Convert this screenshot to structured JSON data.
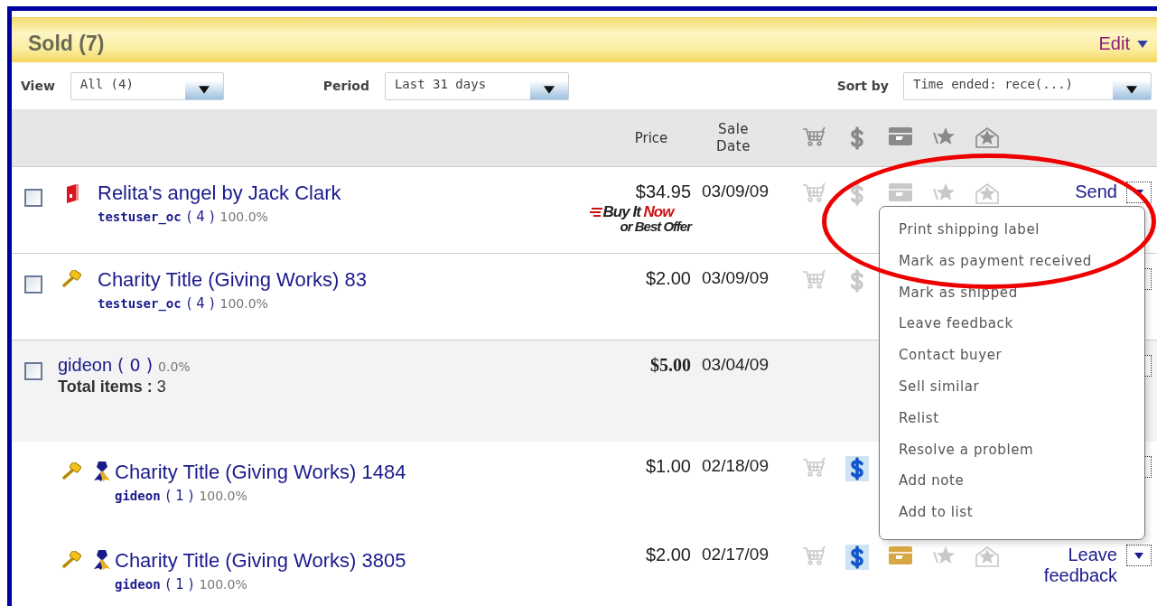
{
  "header": {
    "title": "Sold (7)",
    "edit": "Edit"
  },
  "filters": [
    {
      "label": "View",
      "value": "All (4)"
    },
    {
      "label": "Period",
      "value": "Last 31 days"
    },
    {
      "label": "Sort by",
      "value": "Time ended: rece(...)"
    }
  ],
  "columns": {
    "price": "Price",
    "sale_date": "Sale Date",
    "status_icons": [
      {
        "kind": "cart"
      },
      {
        "kind": "payment"
      },
      {
        "kind": "shipping"
      },
      {
        "kind": "feedback_left"
      },
      {
        "kind": "feedback_received"
      }
    ]
  },
  "rows": [
    {
      "kind": "item",
      "checked": false,
      "auction": false,
      "charity": false,
      "title": "Relita's angel by Jack Clark",
      "seller": "testuser_oc",
      "score": "( 4 )",
      "rating": "100.0%",
      "price": "$34.95",
      "date": "03/09/09",
      "format_logo": {
        "line_1": "Buy It",
        "line_1_accent": "Now",
        "line_2": "or Best Offer"
      },
      "status": [
        {
          "kind": "cart",
          "on": false
        },
        {
          "kind": "payment",
          "on": false
        },
        {
          "kind": "shipping",
          "on": false
        },
        {
          "kind": "feedback_left",
          "on": false
        },
        {
          "kind": "feedback_received",
          "on": false
        }
      ],
      "action": "Send"
    },
    {
      "kind": "item",
      "checked": false,
      "auction": true,
      "charity": false,
      "title": "Charity Title (Giving Works) 83",
      "seller": "testuser_oc",
      "score": "( 4 )",
      "rating": "100.0%",
      "price": "$2.00",
      "date": "03/09/09",
      "status": [
        {
          "kind": "cart",
          "on": false
        },
        {
          "kind": "payment",
          "on": false
        }
      ]
    },
    {
      "kind": "group",
      "checked": false,
      "seller": "gideon",
      "score": "( 0 )",
      "rating": "0.0%",
      "total": "**Total items :** 3",
      "price": "$5.00",
      "date": "03/04/09",
      "status": []
    },
    {
      "kind": "sub_item",
      "auction": true,
      "charity": true,
      "title": "Charity Title (Giving Works) 1484",
      "seller": "gideon",
      "score": "( 1 )",
      "rating": "100.0%",
      "price": "$1.00",
      "date": "02/18/09",
      "status": [
        {
          "kind": "cart",
          "on": false
        },
        {
          "kind": "payment",
          "on": true
        }
      ]
    },
    {
      "kind": "sub_item",
      "auction": true,
      "charity": true,
      "title": "Charity Title (Giving Works) 3805",
      "seller": "gideon",
      "score": "( 1 )",
      "rating": "100.0%",
      "price": "$2.00",
      "date": "02/17/09",
      "status": [
        {
          "kind": "cart",
          "on": false
        },
        {
          "kind": "payment",
          "on": true
        },
        {
          "kind": "shipping",
          "on": true
        },
        {
          "kind": "feedback_left",
          "on": false
        },
        {
          "kind": "feedback_received",
          "on": false
        }
      ],
      "action": "Leave feedback"
    }
  ],
  "menu": {
    "items": [
      "Print shipping label",
      "Mark as payment received",
      "Mark as shipped",
      "Leave feedback",
      "Contact buyer",
      "Sell similar",
      "Relist",
      "Resolve a problem",
      "Add note",
      "Add to list"
    ]
  },
  "annotation": {
    "kind": "ellipse"
  }
}
